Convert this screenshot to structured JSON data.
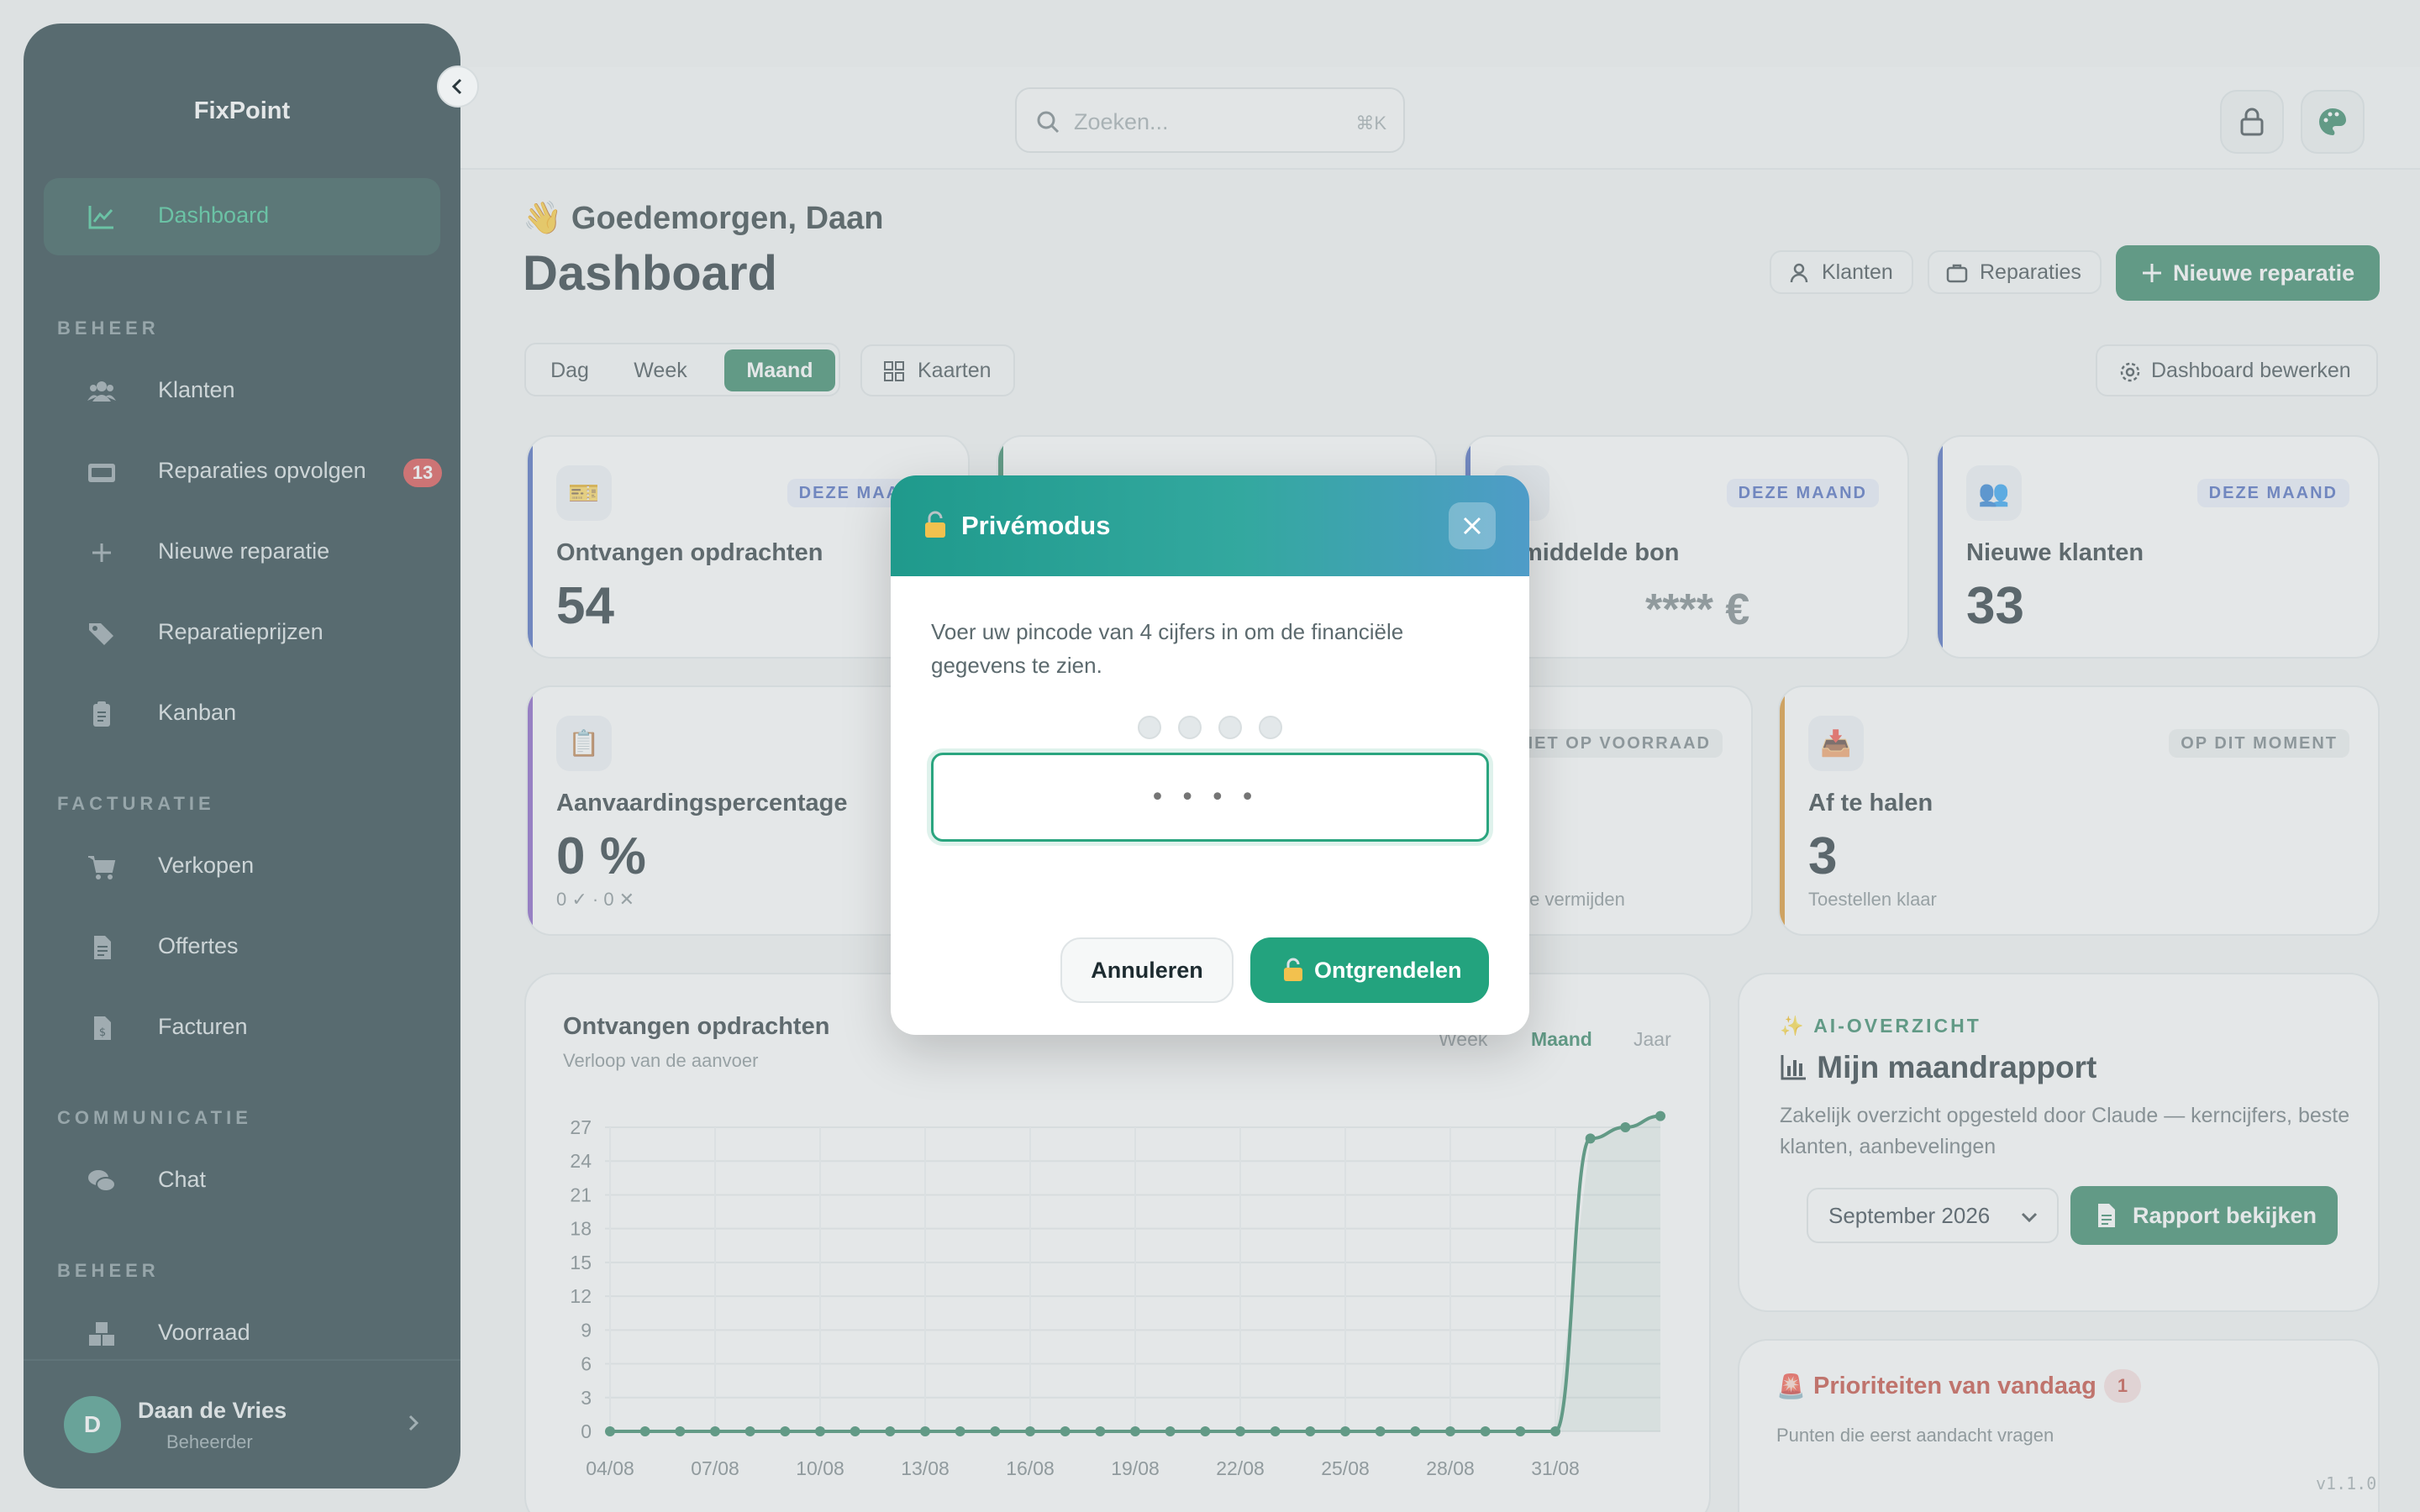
{
  "app": {
    "brand": "FixPoint",
    "version": "v1.1.0"
  },
  "sidebar": {
    "items": [
      {
        "label": "Dashboard",
        "icon": "chart-line-icon",
        "active": true
      },
      {
        "label": "Klanten",
        "icon": "users-icon"
      },
      {
        "label": "Reparaties opvolgen",
        "icon": "card-icon",
        "badge": "13"
      },
      {
        "label": "Nieuwe reparatie",
        "icon": "plus-icon"
      },
      {
        "label": "Reparatieprijzen",
        "icon": "tags-icon"
      },
      {
        "label": "Kanban",
        "icon": "clipboard-icon"
      },
      {
        "label": "Verkopen",
        "icon": "cart-icon"
      },
      {
        "label": "Offertes",
        "icon": "document-icon"
      },
      {
        "label": "Facturen",
        "icon": "invoice-icon"
      },
      {
        "label": "Chat",
        "icon": "chat-icon"
      },
      {
        "label": "Voorraad",
        "icon": "boxes-icon"
      }
    ],
    "sections": [
      "BEHEER",
      "FACTURATIE",
      "COMMUNICATIE",
      "BEHEER"
    ],
    "user": {
      "initial": "D",
      "name": "Daan de Vries",
      "role": "Beheerder"
    }
  },
  "topbar": {
    "search_placeholder": "Zoeken...",
    "search_shortcut": "⌘K"
  },
  "header": {
    "greeting_emoji": "👋",
    "greeting": "Goedemorgen, Daan",
    "title": "Dashboard",
    "btn_klanten": "Klanten",
    "btn_reparaties": "Reparaties",
    "btn_new": "Nieuwe reparatie"
  },
  "filters": {
    "periods": [
      "Dag",
      "Week",
      "Maand"
    ],
    "active_period": "Maand",
    "cards_btn": "Kaarten",
    "edit_btn": "Dashboard bewerken"
  },
  "cards": {
    "received": {
      "icon": "🎫",
      "tag": "DEZE MAAND",
      "title": "Ontvangen opdrachten",
      "value": "54"
    },
    "average": {
      "tag": "DEZE MAAND",
      "title": "middelde bon",
      "value": "**** €"
    },
    "new_clients": {
      "icon": "👥",
      "tag": "DEZE MAAND",
      "title": "Nieuwe klanten",
      "value": "33"
    },
    "acceptance": {
      "icon": "📋",
      "title": "Aanvaardingspercentage",
      "value": "0 %",
      "sub": "0 ✓ · 0 ✕"
    },
    "stock": {
      "tag": "NIET OP VOORRAAD",
      "sub": "te vermijden"
    },
    "pickup": {
      "icon": "📥",
      "tag": "OP DIT MOMENT",
      "title": "Af te halen",
      "value": "3",
      "sub": "Toestellen klaar"
    }
  },
  "chart": {
    "title": "Ontvangen opdrachten",
    "subtitle": "Verloop van de aanvoer",
    "tabs": [
      "Week",
      "Maand",
      "Jaar"
    ],
    "active_tab": "Maand"
  },
  "chart_data": {
    "type": "line",
    "title": "Ontvangen opdrachten",
    "xlabel": "",
    "ylabel": "",
    "ylim": [
      0,
      27
    ],
    "yticks": [
      0,
      3,
      6,
      9,
      12,
      15,
      18,
      21,
      24,
      27
    ],
    "xtick_labels": [
      "04/08",
      "07/08",
      "10/08",
      "13/08",
      "16/08",
      "19/08",
      "22/08",
      "25/08",
      "28/08",
      "31/08"
    ],
    "x": [
      "04/08",
      "05/08",
      "06/08",
      "07/08",
      "08/08",
      "09/08",
      "10/08",
      "11/08",
      "12/08",
      "13/08",
      "14/08",
      "15/08",
      "16/08",
      "17/08",
      "18/08",
      "19/08",
      "20/08",
      "21/08",
      "22/08",
      "23/08",
      "24/08",
      "25/08",
      "26/08",
      "27/08",
      "28/08",
      "29/08",
      "30/08",
      "31/08",
      "01/09",
      "02/09",
      "03/09"
    ],
    "series": [
      {
        "values": [
          0,
          0,
          0,
          0,
          0,
          0,
          0,
          0,
          0,
          0,
          0,
          0,
          0,
          0,
          0,
          0,
          0,
          0,
          0,
          0,
          0,
          0,
          0,
          0,
          0,
          0,
          0,
          0,
          26,
          27,
          28
        ]
      }
    ],
    "color": "#1f7a57",
    "grid": true
  },
  "ai": {
    "kicker": "AI-OVERZICHT",
    "title": "Mijn maandrapport",
    "description": "Zakelijk overzicht opgesteld door Claude — kerncijfers, beste klanten, aanbevelingen",
    "month": "September 2026",
    "report_btn": "Rapport bekijken"
  },
  "priorities": {
    "title": "Prioriteiten van vandaag",
    "count": "1",
    "subtitle": "Punten die eerst aandacht vragen"
  },
  "modal": {
    "title": "Privémodus",
    "text": "Voer uw pincode van 4 cijfers in om de financiële gegevens te zien.",
    "pin_placeholder": "••••",
    "cancel": "Annuleren",
    "unlock": "Ontgrendelen"
  },
  "colors": {
    "accent": "#1f7a57",
    "sidebar_bg": "#0f2a31",
    "danger": "#d83a3a",
    "modal_gradient_start": "#1f9a8c",
    "modal_gradient_end": "#4f9cc8"
  }
}
